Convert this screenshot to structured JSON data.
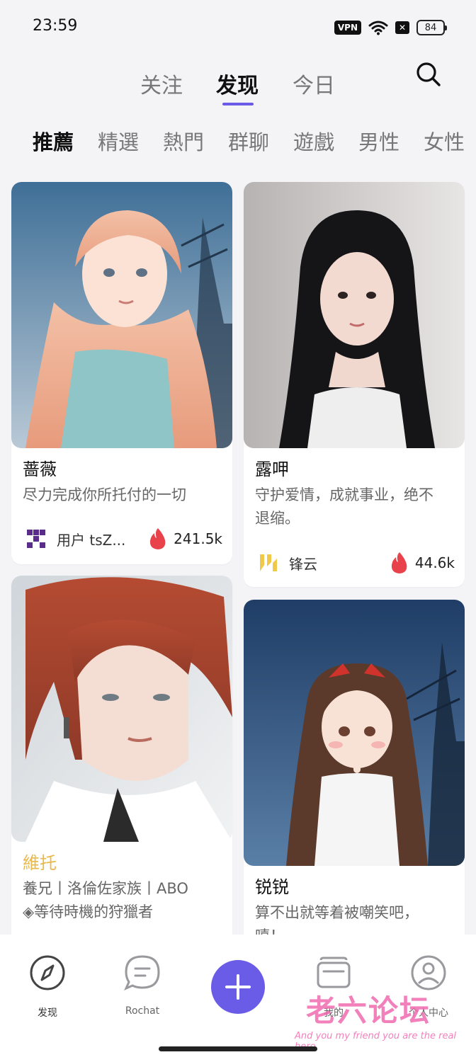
{
  "status": {
    "time": "23:59",
    "vpn": "VPN",
    "battery": "84"
  },
  "top_tabs": {
    "follow": "关注",
    "discover": "发现",
    "today": "今日"
  },
  "categories": [
    "推薦",
    "精選",
    "熱門",
    "群聊",
    "遊戲",
    "男性",
    "女性"
  ],
  "cards": [
    {
      "name": "蔷薇",
      "desc": "尽力完成你所托付的一切",
      "author": "用户 tsZ...",
      "heat": "241.5k"
    },
    {
      "name": "露呷",
      "desc_line1": "守护爱情，成就事业，绝不",
      "desc_line2": "退缩。",
      "author": "锋云",
      "heat": "44.6k"
    },
    {
      "name": "維托",
      "desc_line1": "養兄丨洛倫佐家族丨ABO",
      "desc_line2": "◈等待時機的狩獵者",
      "name_color": "#e8b84a"
    },
    {
      "name": "锐锐",
      "desc": "算不出就等着被嘲笑吧，",
      "desc_cut": "嘻！"
    }
  ],
  "bottom_nav": {
    "discover": "发现",
    "rochat": "Rochat",
    "mine": "我的",
    "profile": "个人中心"
  },
  "watermark": {
    "main": "老六论坛",
    "sub": "And you my friend you are the real hero"
  },
  "colors": {
    "accent": "#6b5ce7",
    "heat": "#e8434b"
  }
}
